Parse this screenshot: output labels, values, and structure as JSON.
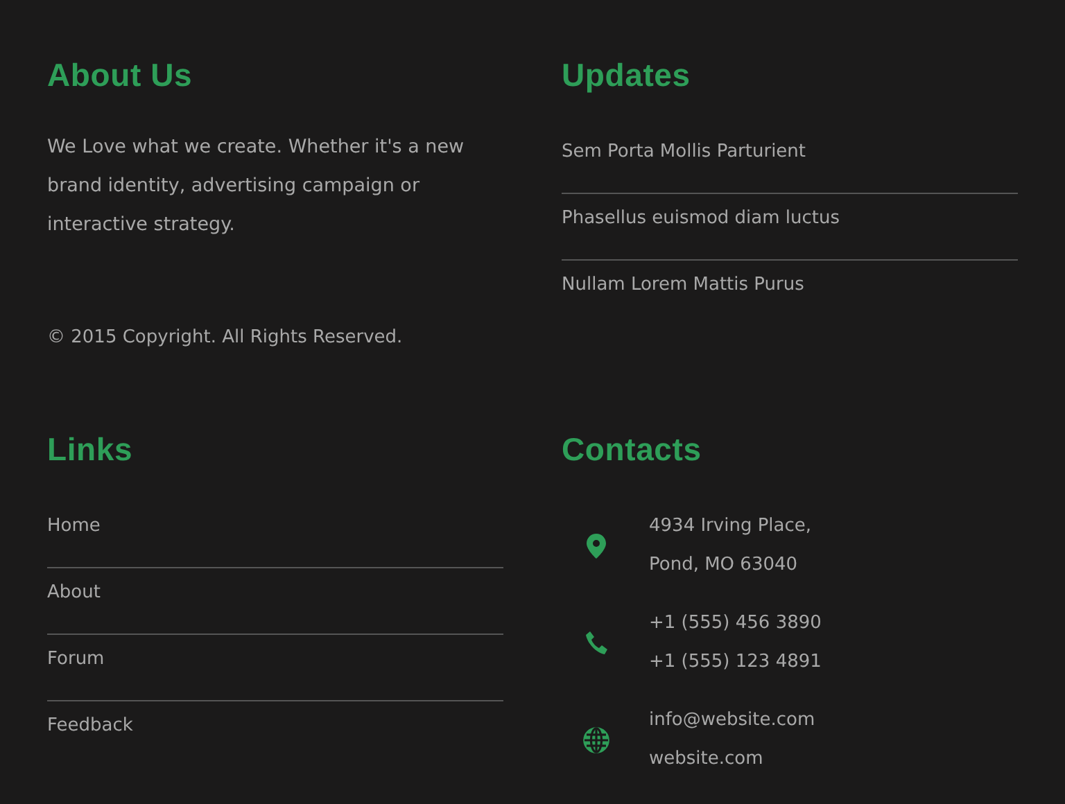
{
  "about": {
    "title": "About Us",
    "text": "We Love what we create. Whether it's a new brand identity, advertising campaign or interactive strategy.",
    "copyright": "© 2015 Copyright. All Rights Reserved."
  },
  "updates": {
    "title": "Updates",
    "items": [
      "Sem Porta Mollis Parturient",
      "Phasellus euismod diam luctus",
      "Nullam Lorem Mattis Purus"
    ]
  },
  "links": {
    "title": "Links",
    "items": [
      "Home",
      "About",
      "Forum",
      "Feedback"
    ]
  },
  "contacts": {
    "title": "Contacts",
    "items": [
      {
        "kind": "location",
        "lines": [
          "4934 Irving Place,",
          "Pond, MO 63040"
        ]
      },
      {
        "kind": "phone",
        "lines": [
          "+1 (555) 456 3890",
          "+1 (555) 123 4891"
        ]
      },
      {
        "kind": "web",
        "lines": [
          "info@website.com",
          "website.com"
        ]
      }
    ]
  }
}
